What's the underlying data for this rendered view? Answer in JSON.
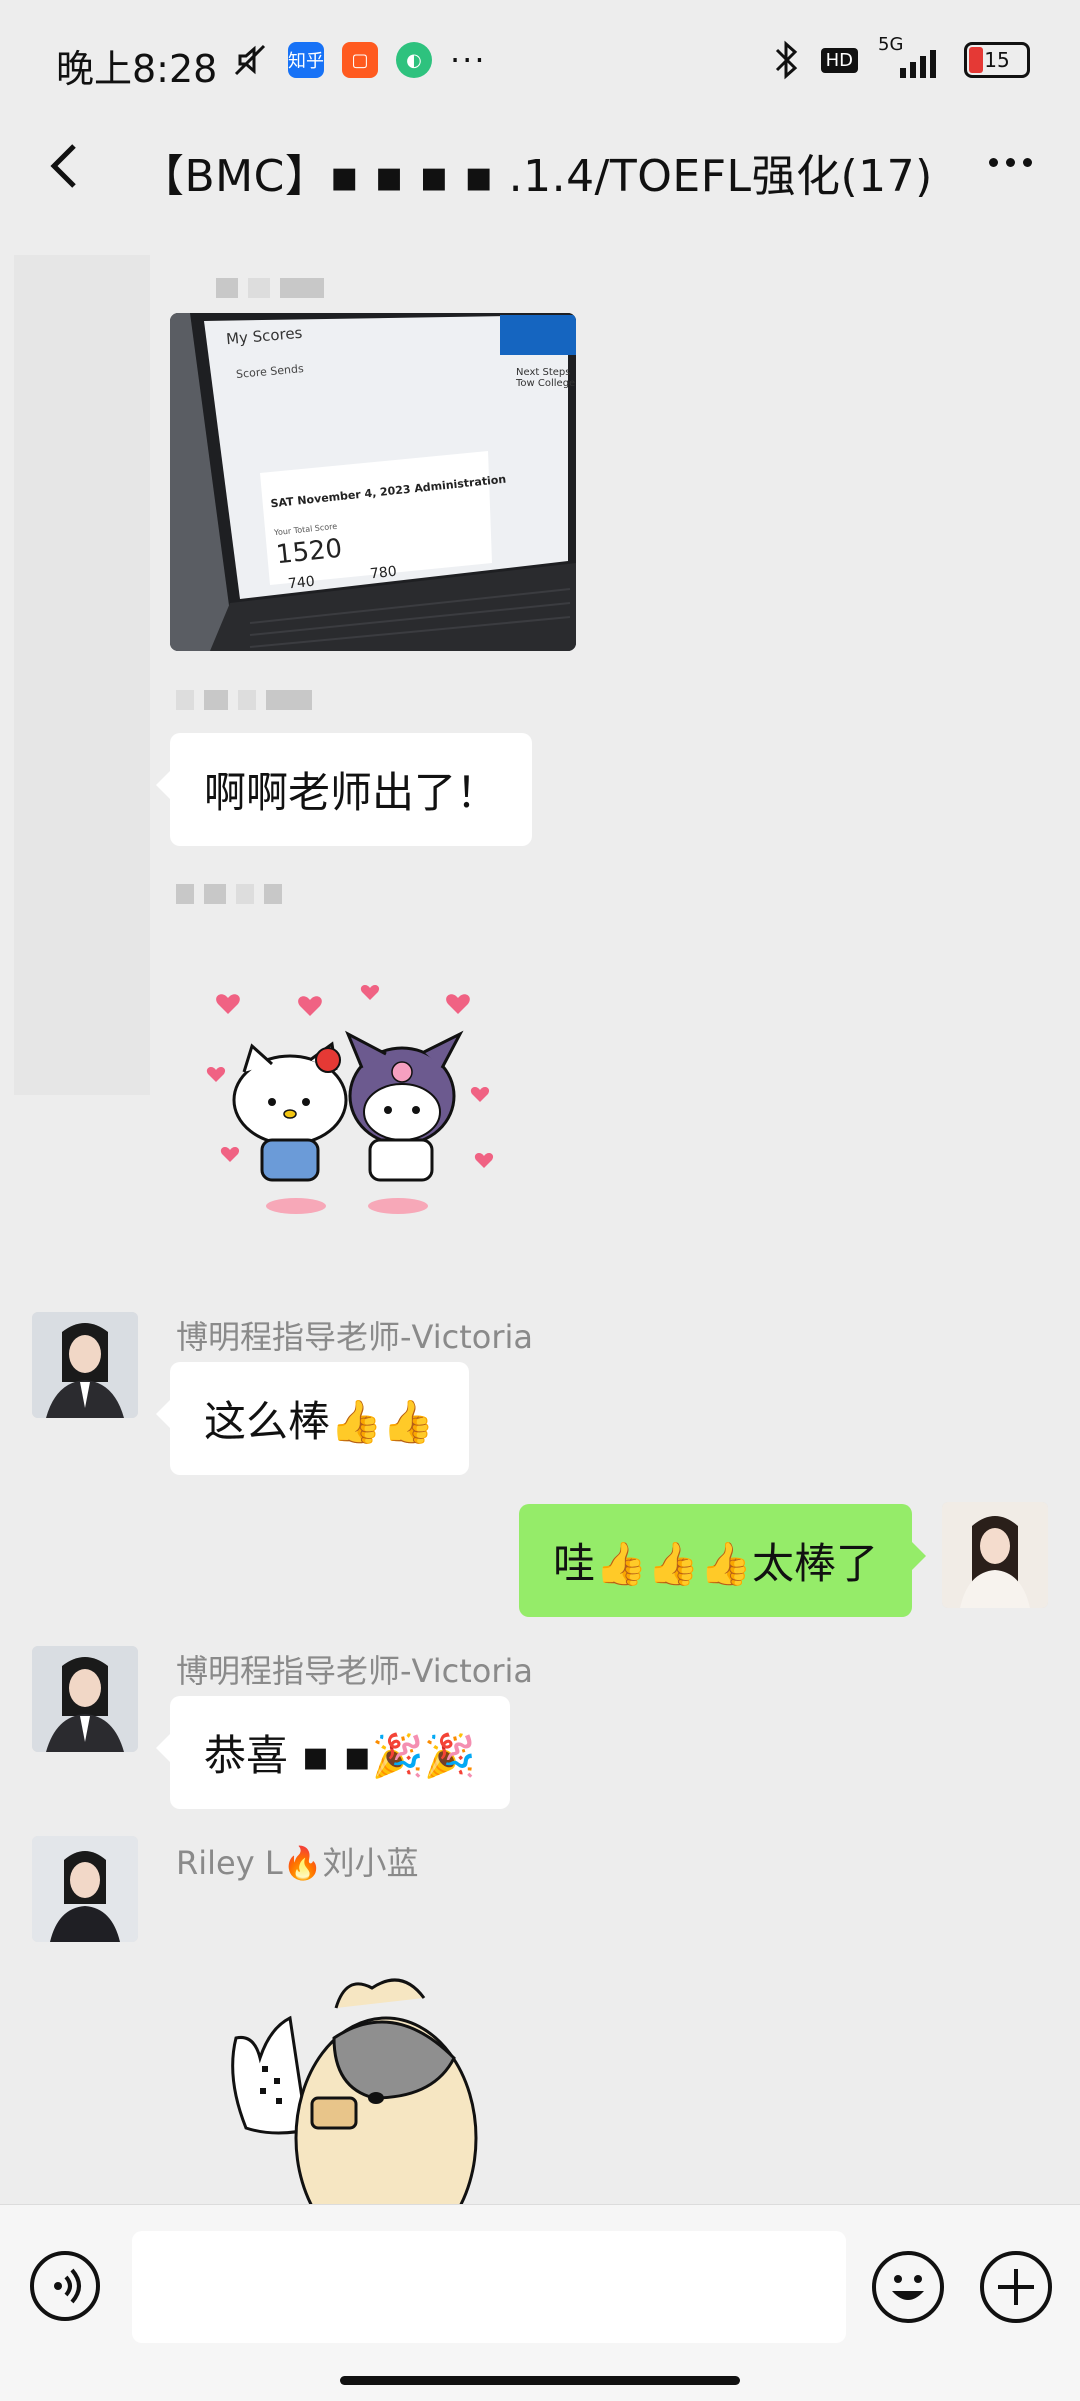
{
  "status_bar": {
    "time": "晚上8:28",
    "app_icons": [
      "mute-icon",
      "zhihu-icon",
      "taobao-icon",
      "app-icon",
      "more-icon"
    ],
    "zhihu_label": "知乎",
    "network": "5G",
    "hd_badge": "HD",
    "battery": "15"
  },
  "header": {
    "title": "【BMC】▪ ▪ ▪ ▪   .1.4/TOEFL强化(17)"
  },
  "messages": [
    {
      "type": "image",
      "image_texts": {
        "heading": "My Scores",
        "subheading": "Score Sends",
        "admin": "SAT November 4, 2023 Administration",
        "total_label": "Your Total Score",
        "total": "1520",
        "score_a": "740",
        "score_b": "780",
        "next_steps": "Next Steps Tow College"
      }
    },
    {
      "type": "text",
      "side": "left",
      "text": "啊啊老师出了！"
    },
    {
      "type": "sticker",
      "side": "left",
      "sticker": "hello-kitty-kuromi"
    },
    {
      "type": "text",
      "side": "left",
      "sender": "博明程指导老师-Victoria",
      "text": "这么棒👍👍"
    },
    {
      "type": "text",
      "side": "right",
      "text": "哇👍👍👍太棒了"
    },
    {
      "type": "text",
      "side": "left",
      "sender": "博明程指导老师-Victoria",
      "text": "恭喜  ▪  ▪🎉🎉"
    },
    {
      "type": "sticker",
      "side": "left",
      "sender": "Riley L🔥刘小蓝",
      "sticker": "hamster-with-sign"
    }
  ],
  "colors": {
    "background": "#ededed",
    "bubble_self": "#95ec69",
    "bubble_other": "#ffffff"
  }
}
